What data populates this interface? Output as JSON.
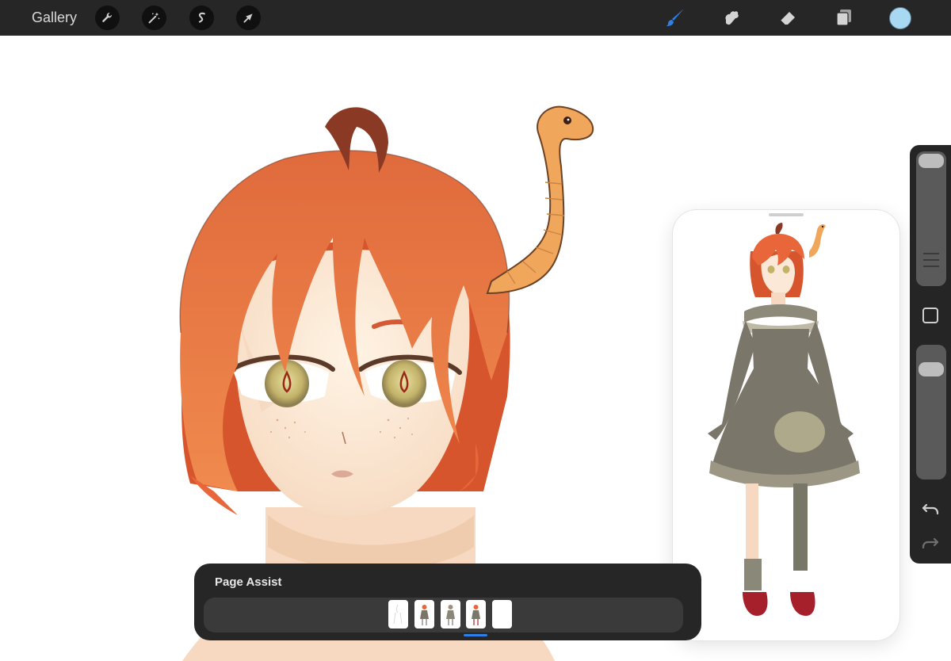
{
  "topbar": {
    "gallery_label": "Gallery",
    "left_tools": [
      {
        "icon": "wrench-icon",
        "name": "actions"
      },
      {
        "icon": "magic-wand-icon",
        "name": "adjustments"
      },
      {
        "icon": "selection-icon",
        "name": "selection"
      },
      {
        "icon": "arrow-cursor-icon",
        "name": "transform"
      }
    ],
    "right_tools": [
      {
        "icon": "brush-icon",
        "name": "brush",
        "active": true
      },
      {
        "icon": "smudge-icon",
        "name": "smudge",
        "active": false
      },
      {
        "icon": "eraser-icon",
        "name": "eraser",
        "active": false
      },
      {
        "icon": "layers-icon",
        "name": "layers",
        "active": false
      }
    ],
    "current_color": "#a9d8f2"
  },
  "colors": {
    "topbar_bg": "#262626",
    "active_tool": "#2f7fe6",
    "hair": "#e8663a",
    "worm": "#f0a65b",
    "dress": "#7a7669"
  },
  "sidebar": {
    "brush_size_level": 0.05,
    "opacity_level": 0.12,
    "undo_icon": "undo-icon",
    "redo_icon": "redo-icon"
  },
  "reference_window": {
    "content": "full-body character reference"
  },
  "page_assist": {
    "title": "Page Assist",
    "page_count": 5,
    "current_page": 4
  }
}
